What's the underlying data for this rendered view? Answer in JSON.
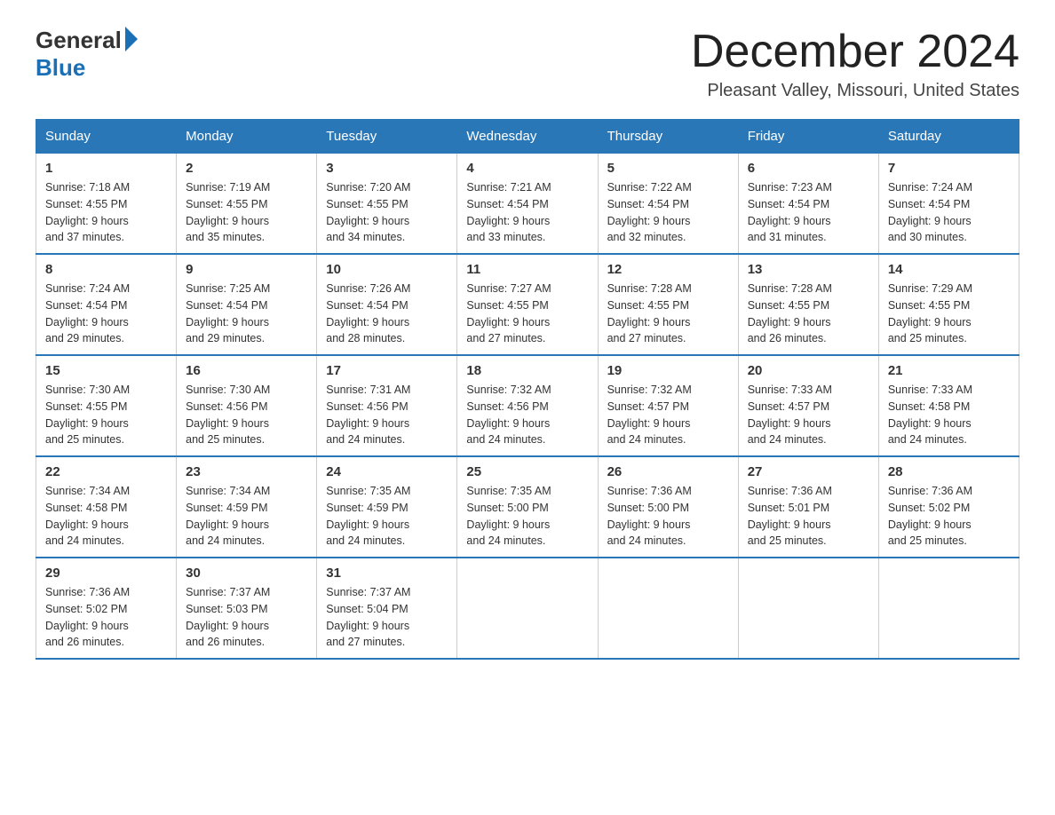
{
  "header": {
    "logo_general": "General",
    "logo_blue": "Blue",
    "month_title": "December 2024",
    "location": "Pleasant Valley, Missouri, United States"
  },
  "days_of_week": [
    "Sunday",
    "Monday",
    "Tuesday",
    "Wednesday",
    "Thursday",
    "Friday",
    "Saturday"
  ],
  "weeks": [
    [
      {
        "num": "1",
        "sunrise": "7:18 AM",
        "sunset": "4:55 PM",
        "daylight": "9 hours and 37 minutes."
      },
      {
        "num": "2",
        "sunrise": "7:19 AM",
        "sunset": "4:55 PM",
        "daylight": "9 hours and 35 minutes."
      },
      {
        "num": "3",
        "sunrise": "7:20 AM",
        "sunset": "4:55 PM",
        "daylight": "9 hours and 34 minutes."
      },
      {
        "num": "4",
        "sunrise": "7:21 AM",
        "sunset": "4:54 PM",
        "daylight": "9 hours and 33 minutes."
      },
      {
        "num": "5",
        "sunrise": "7:22 AM",
        "sunset": "4:54 PM",
        "daylight": "9 hours and 32 minutes."
      },
      {
        "num": "6",
        "sunrise": "7:23 AM",
        "sunset": "4:54 PM",
        "daylight": "9 hours and 31 minutes."
      },
      {
        "num": "7",
        "sunrise": "7:24 AM",
        "sunset": "4:54 PM",
        "daylight": "9 hours and 30 minutes."
      }
    ],
    [
      {
        "num": "8",
        "sunrise": "7:24 AM",
        "sunset": "4:54 PM",
        "daylight": "9 hours and 29 minutes."
      },
      {
        "num": "9",
        "sunrise": "7:25 AM",
        "sunset": "4:54 PM",
        "daylight": "9 hours and 29 minutes."
      },
      {
        "num": "10",
        "sunrise": "7:26 AM",
        "sunset": "4:54 PM",
        "daylight": "9 hours and 28 minutes."
      },
      {
        "num": "11",
        "sunrise": "7:27 AM",
        "sunset": "4:55 PM",
        "daylight": "9 hours and 27 minutes."
      },
      {
        "num": "12",
        "sunrise": "7:28 AM",
        "sunset": "4:55 PM",
        "daylight": "9 hours and 27 minutes."
      },
      {
        "num": "13",
        "sunrise": "7:28 AM",
        "sunset": "4:55 PM",
        "daylight": "9 hours and 26 minutes."
      },
      {
        "num": "14",
        "sunrise": "7:29 AM",
        "sunset": "4:55 PM",
        "daylight": "9 hours and 25 minutes."
      }
    ],
    [
      {
        "num": "15",
        "sunrise": "7:30 AM",
        "sunset": "4:55 PM",
        "daylight": "9 hours and 25 minutes."
      },
      {
        "num": "16",
        "sunrise": "7:30 AM",
        "sunset": "4:56 PM",
        "daylight": "9 hours and 25 minutes."
      },
      {
        "num": "17",
        "sunrise": "7:31 AM",
        "sunset": "4:56 PM",
        "daylight": "9 hours and 24 minutes."
      },
      {
        "num": "18",
        "sunrise": "7:32 AM",
        "sunset": "4:56 PM",
        "daylight": "9 hours and 24 minutes."
      },
      {
        "num": "19",
        "sunrise": "7:32 AM",
        "sunset": "4:57 PM",
        "daylight": "9 hours and 24 minutes."
      },
      {
        "num": "20",
        "sunrise": "7:33 AM",
        "sunset": "4:57 PM",
        "daylight": "9 hours and 24 minutes."
      },
      {
        "num": "21",
        "sunrise": "7:33 AM",
        "sunset": "4:58 PM",
        "daylight": "9 hours and 24 minutes."
      }
    ],
    [
      {
        "num": "22",
        "sunrise": "7:34 AM",
        "sunset": "4:58 PM",
        "daylight": "9 hours and 24 minutes."
      },
      {
        "num": "23",
        "sunrise": "7:34 AM",
        "sunset": "4:59 PM",
        "daylight": "9 hours and 24 minutes."
      },
      {
        "num": "24",
        "sunrise": "7:35 AM",
        "sunset": "4:59 PM",
        "daylight": "9 hours and 24 minutes."
      },
      {
        "num": "25",
        "sunrise": "7:35 AM",
        "sunset": "5:00 PM",
        "daylight": "9 hours and 24 minutes."
      },
      {
        "num": "26",
        "sunrise": "7:36 AM",
        "sunset": "5:00 PM",
        "daylight": "9 hours and 24 minutes."
      },
      {
        "num": "27",
        "sunrise": "7:36 AM",
        "sunset": "5:01 PM",
        "daylight": "9 hours and 25 minutes."
      },
      {
        "num": "28",
        "sunrise": "7:36 AM",
        "sunset": "5:02 PM",
        "daylight": "9 hours and 25 minutes."
      }
    ],
    [
      {
        "num": "29",
        "sunrise": "7:36 AM",
        "sunset": "5:02 PM",
        "daylight": "9 hours and 26 minutes."
      },
      {
        "num": "30",
        "sunrise": "7:37 AM",
        "sunset": "5:03 PM",
        "daylight": "9 hours and 26 minutes."
      },
      {
        "num": "31",
        "sunrise": "7:37 AM",
        "sunset": "5:04 PM",
        "daylight": "9 hours and 27 minutes."
      },
      null,
      null,
      null,
      null
    ]
  ],
  "labels": {
    "sunrise": "Sunrise:",
    "sunset": "Sunset:",
    "daylight": "Daylight:"
  }
}
